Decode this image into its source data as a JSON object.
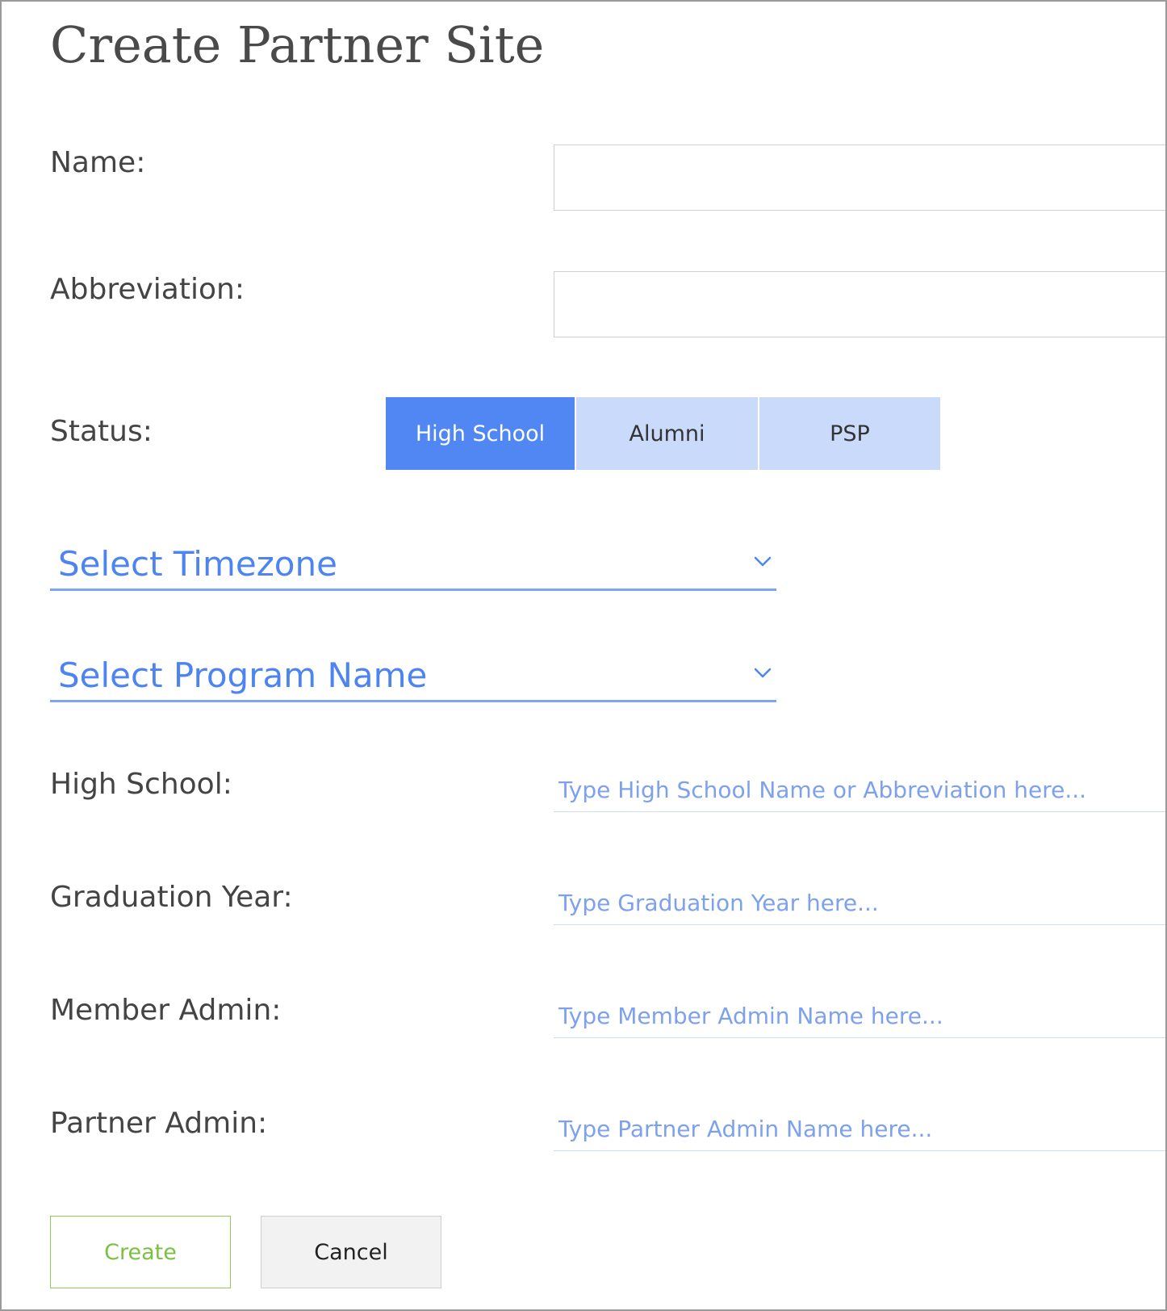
{
  "page": {
    "title": "Create Partner Site"
  },
  "form": {
    "name": {
      "label": "Name:",
      "value": ""
    },
    "abbreviation": {
      "label": "Abbreviation:",
      "value": ""
    },
    "status": {
      "label": "Status:",
      "options": [
        "High School",
        "Alumni",
        "PSP"
      ],
      "selected": "High School"
    },
    "timezone": {
      "placeholder": "Select Timezone",
      "icon": "chevron-down-icon"
    },
    "program": {
      "placeholder": "Select Program Name",
      "icon": "chevron-down-icon"
    },
    "high_school": {
      "label": "High School:",
      "placeholder": "Type High School Name or Abbreviation here..."
    },
    "graduation_year": {
      "label": "Graduation Year:",
      "placeholder": "Type Graduation Year here..."
    },
    "member_admin": {
      "label": "Member Admin:",
      "placeholder": "Type Member Admin Name here..."
    },
    "partner_admin": {
      "label": "Partner Admin:",
      "placeholder": "Type Partner Admin Name here..."
    }
  },
  "actions": {
    "create_label": "Create",
    "cancel_label": "Cancel"
  },
  "colors": {
    "accent_blue": "#5187f3",
    "segment_inactive": "#c9dafb",
    "create_green": "#7bc043"
  }
}
